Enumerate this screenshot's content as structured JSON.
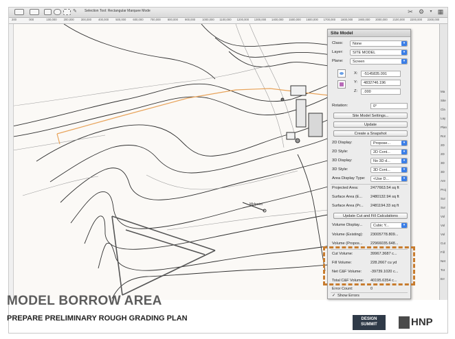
{
  "toolbar": {
    "mode_text": "Selection Tool: Rectangular Marquee Mode"
  },
  "ruler": {
    "labels": [
      "200",
      "000",
      "100,000",
      "200,000",
      "300,000",
      "400,000",
      "500,000",
      "600,000",
      "700,000",
      "800,000",
      "900,000",
      "1000,000",
      "1100,000",
      "1200,000",
      "1300,000",
      "1400,000",
      "1500,000",
      "1600,000",
      "1700,000",
      "1800,000",
      "1900,000",
      "2000,000",
      "2100,000",
      "2200,000",
      "2300,000"
    ]
  },
  "drawing": {
    "label": "Midpoint"
  },
  "oip": {
    "title": "Site Model",
    "class_label": "Class:",
    "class_value": "None",
    "layer_label": "Layer:",
    "layer_value": "SITE MODEL",
    "plane_label": "Plane:",
    "plane_value": "Screen",
    "x_label": "X:",
    "x_value": "-5145835.091",
    "y_label": "Y:",
    "y_value": "4832746.196",
    "z_label": "Z:",
    "z_value": ".000",
    "rotation_label": "Rotation:",
    "rotation_value": "0°",
    "btn_settings": "Site Model Settings...",
    "btn_update": "Update",
    "btn_snapshot": "Create a Snapshot",
    "display_2d_label": "2D Display:",
    "display_2d_value": "Propose...",
    "style_2d_label": "2D Style:",
    "style_2d_value": "2D Cont...",
    "display_3d_label": "3D Display:",
    "display_3d_value": "No 3D d...",
    "style_3d_label": "3D Style:",
    "style_3d_value": "3D Cont...",
    "area_type_label": "Area Display Type:",
    "area_type_value": "<Use D...",
    "proj_area_label": "Projected Area:",
    "proj_area_value": "2477663.54 sq ft",
    "surf_e_label": "Surface Area (E...",
    "surf_e_value": "2480132.94 sq ft",
    "surf_p_label": "Surface Area (Pr...",
    "surf_p_value": "2481194.33 sq ft",
    "btn_cutfill": "Update Cut and Fill Calculations",
    "vol_display_label": "Volume Display...",
    "vol_display_value": "Cubic Y...",
    "vol_exist_label": "Volume (Existing):",
    "vol_exist_value": "23005778.809...",
    "vol_prop_label": "Volume (Propos...",
    "vol_prop_value": "22966035.648...",
    "cut_label": "Cut Volume:",
    "cut_value": "39967.3687 c...",
    "fill_label": "Fill Volume:",
    "fill_value": "228.2667 cu yd",
    "net_label": "Net C&F Volume:",
    "net_value": "-39739.1020 c...",
    "total_label": "Total C&F Volume:",
    "total_value": "40195.6354 c...",
    "errcount_label": "Error Count:",
    "errcount_value": "0",
    "show_errors_check": "✓",
    "show_errors_label": "Show Errors"
  },
  "rightstrip": {
    "items": [
      "Ma",
      "Site",
      "Cla",
      "Lay",
      "Plan",
      "Rot",
      "2D",
      "2D",
      "3D",
      "3D",
      "Are",
      "Proj",
      "Sur",
      "Sur",
      "Vol",
      "Vol",
      "Vol",
      "Cut",
      "Fill",
      "Net",
      "Tot",
      "Err"
    ]
  },
  "footer": {
    "title": "MODEL BORROW AREA",
    "subtitle": "PREPARE PRELIMINARY ROUGH GRADING PLAN",
    "logo1_line1": "DESIGN",
    "logo1_line2": "SUMMIT",
    "logo2_text": "HNP"
  },
  "colors": {
    "accent_blue": "#3a7ee8",
    "highlight_orange": "#c87c2e",
    "site_boundary": "#e8a35a"
  }
}
